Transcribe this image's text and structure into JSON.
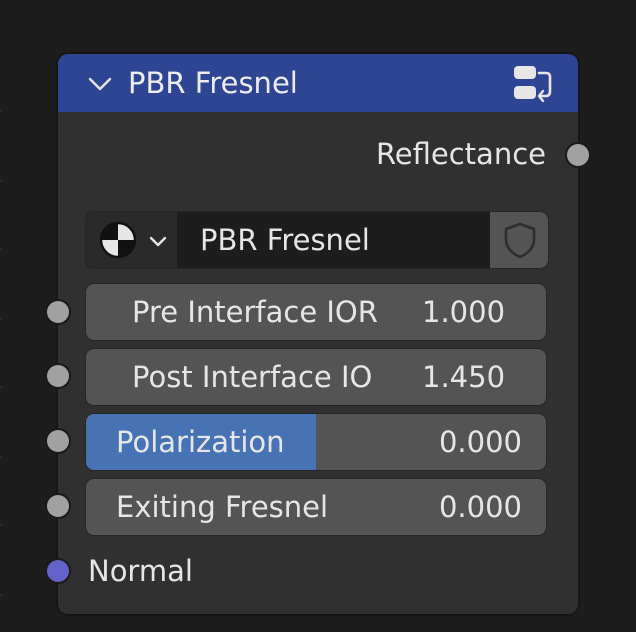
{
  "node": {
    "title": "PBR Fresnel",
    "header_color": "#2d4593",
    "icons": {
      "collapse": "chevron-down-icon",
      "group": "node-group-icon"
    }
  },
  "outputs": [
    {
      "label": "Reflectance",
      "socket_color": "#a1a1a1"
    }
  ],
  "datablock": {
    "browse_icon": "node-tree-browse-icon",
    "name": "PBR Fresnel",
    "fake_user_icon": "shield-icon"
  },
  "inputs": [
    {
      "label": "Pre Interface IOR",
      "value": "1.000"
    },
    {
      "label": "Post Interface IO",
      "value": "1.450"
    },
    {
      "label": "Polarization",
      "value": "0.000",
      "fill_fraction": 0.5
    },
    {
      "label": "Exiting Fresnel",
      "value": "0.000"
    }
  ],
  "vector_input": {
    "label": "Normal",
    "socket_color": "#6363c7"
  },
  "colors": {
    "accent": "#4772b3",
    "field": "#545454",
    "node_body": "#303030",
    "background": "#1d1d1d"
  }
}
